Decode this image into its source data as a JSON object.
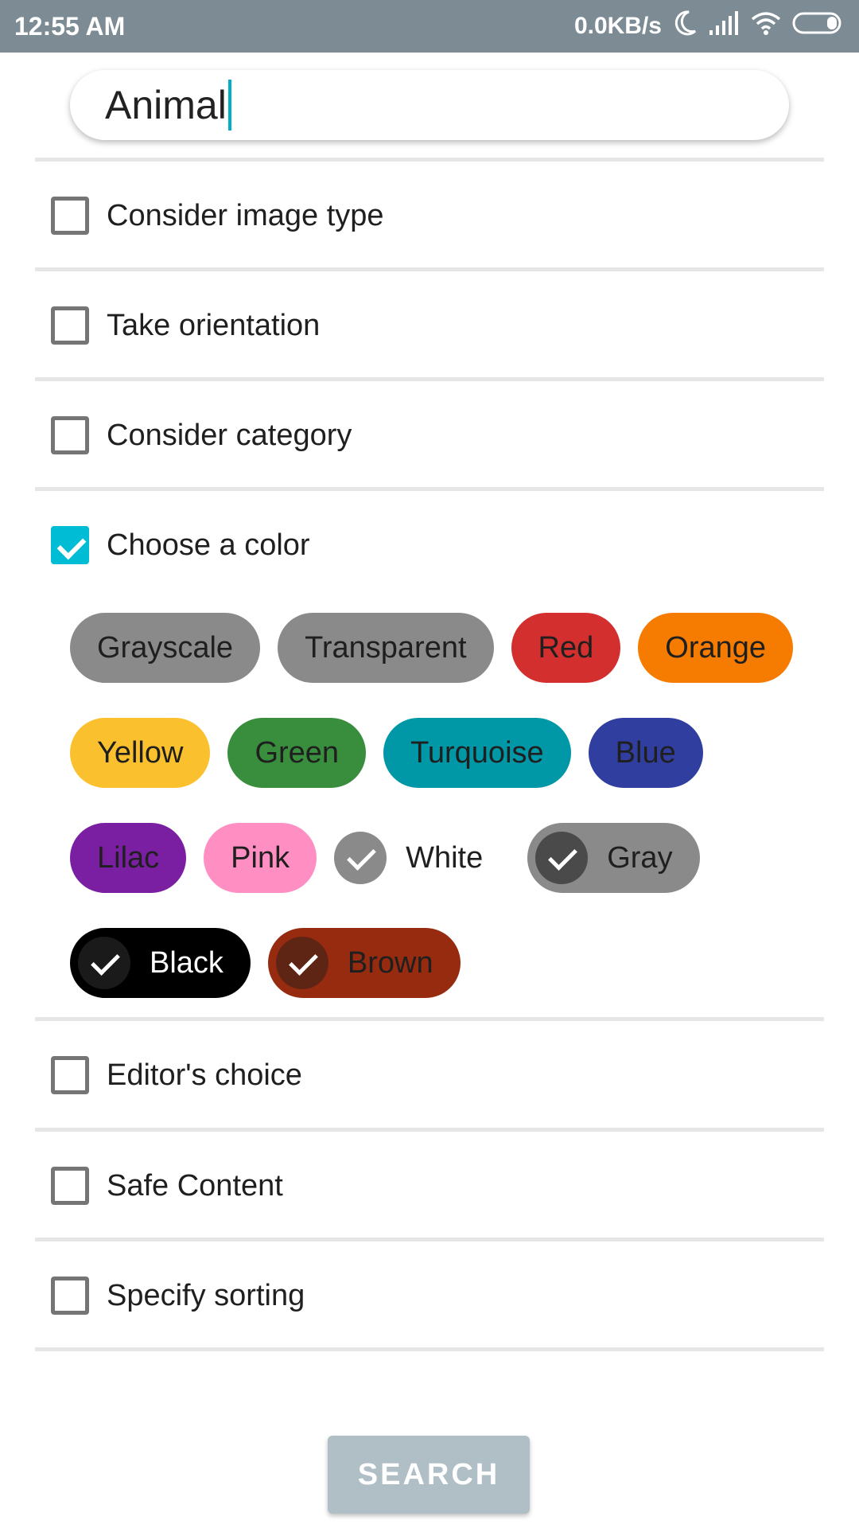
{
  "status_bar": {
    "time": "12:55 AM",
    "speed": "0.0KB/s"
  },
  "search": {
    "value": "Animal"
  },
  "options": [
    {
      "label": "Consider image type",
      "checked": false
    },
    {
      "label": "Take orientation",
      "checked": false
    },
    {
      "label": "Consider category",
      "checked": false
    },
    {
      "label": "Choose a color",
      "checked": true
    },
    {
      "label": "Editor's choice",
      "checked": false
    },
    {
      "label": "Safe Content",
      "checked": false
    },
    {
      "label": "Specify sorting",
      "checked": false
    }
  ],
  "colors": [
    {
      "label": "Grayscale",
      "bg": "#8a8a8a",
      "text": "#1f1f1f",
      "selected": false
    },
    {
      "label": "Transparent",
      "bg": "#8a8a8a",
      "text": "#1f1f1f",
      "selected": false
    },
    {
      "label": "Red",
      "bg": "#d32f2f",
      "text": "#1f1f1f",
      "selected": false
    },
    {
      "label": "Orange",
      "bg": "#f57c00",
      "text": "#1f1f1f",
      "selected": false
    },
    {
      "label": "Yellow",
      "bg": "#fbc02d",
      "text": "#1f1f1f",
      "selected": false
    },
    {
      "label": "Green",
      "bg": "#388e3c",
      "text": "#1f1f1f",
      "selected": false
    },
    {
      "label": "Turquoise",
      "bg": "#0097a7",
      "text": "#1f1f1f",
      "selected": false
    },
    {
      "label": "Blue",
      "bg": "#303f9f",
      "text": "#1f1f1f",
      "selected": false
    },
    {
      "label": "Lilac",
      "bg": "#7b1fa2",
      "text": "#1f1f1f",
      "selected": false
    },
    {
      "label": "Pink",
      "bg": "#ff8fc3",
      "text": "#1f1f1f",
      "selected": false
    },
    {
      "label": "White",
      "bg": "#ffffff",
      "text": "#1f1f1f",
      "selected": true,
      "tick": "#8a8a8a"
    },
    {
      "label": "Gray",
      "bg": "#8a8a8a",
      "text": "#1f1f1f",
      "selected": true,
      "tick": "#4a4a4a"
    },
    {
      "label": "Black",
      "bg": "#000000",
      "text": "#ffffff",
      "selected": true,
      "tick": "#1a1a1a"
    },
    {
      "label": "Brown",
      "bg": "#962b10",
      "text": "#1f1f1f",
      "selected": true,
      "tick": "#5e2414"
    }
  ],
  "search_button": {
    "label": "SEARCH"
  },
  "theme": {
    "accent": "#00bcd4",
    "status_bar": "#7d8c94",
    "button_disabled": "#b0bec5"
  }
}
